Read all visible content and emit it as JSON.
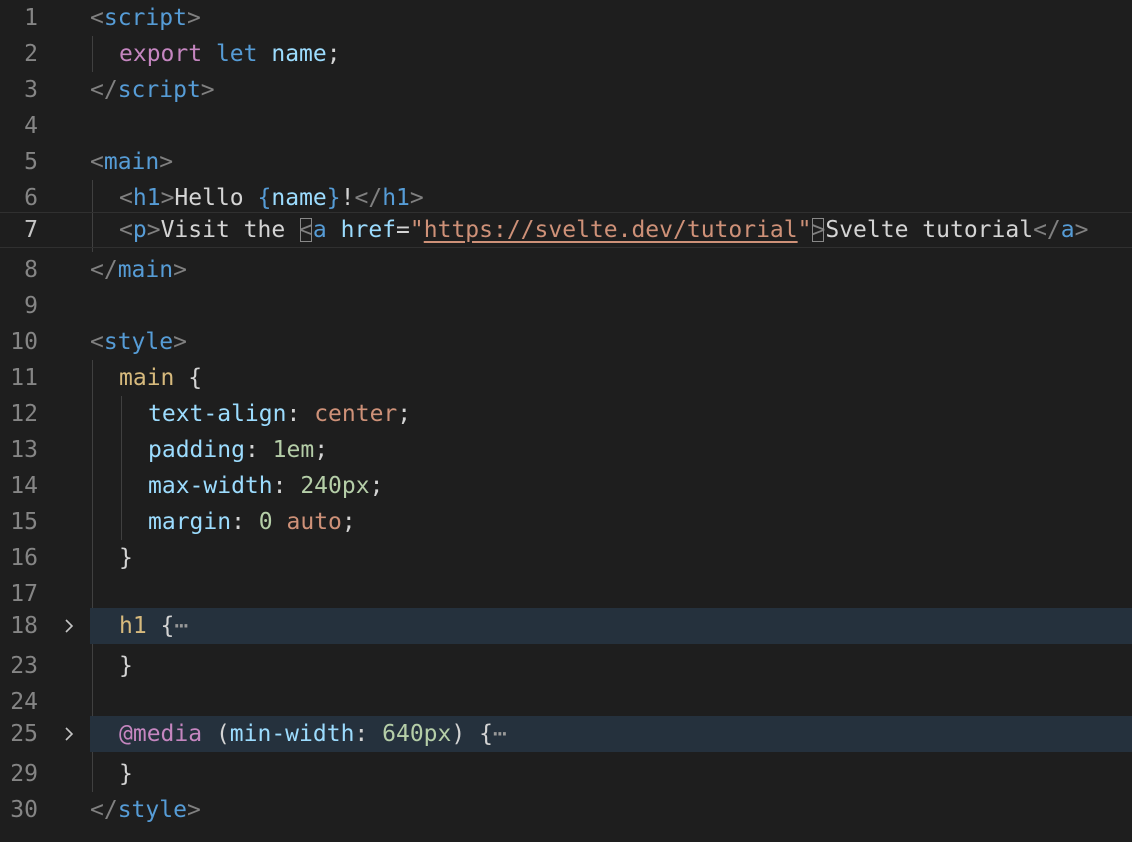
{
  "editor": {
    "line_numbers": [
      "1",
      "2",
      "3",
      "4",
      "5",
      "6",
      "7",
      "8",
      "9",
      "10",
      "11",
      "12",
      "13",
      "14",
      "15",
      "16",
      "17",
      "18",
      "23",
      "24",
      "25",
      "29",
      "30"
    ],
    "lines": {
      "l1": {
        "a": "<",
        "b": "script",
        "c": ">"
      },
      "l2": {
        "a": "export",
        "b": " ",
        "c": "let",
        "d": " name",
        "e": ";"
      },
      "l3": {
        "a": "</",
        "b": "script",
        "c": ">"
      },
      "l5": {
        "a": "<",
        "b": "main",
        "c": ">"
      },
      "l6": {
        "a": "<",
        "b": "h1",
        "c": ">",
        "d": "Hello ",
        "e": "{",
        "f": "name",
        "g": "}",
        "h": "!",
        "i": "</",
        "j": "h1",
        "k": ">"
      },
      "l7": {
        "a": "<",
        "b": "p",
        "c": ">",
        "d": "Visit the ",
        "e": "<",
        "f": "a",
        "g": " href",
        "h": "=",
        "i": "\"",
        "j": "https://svelte.dev/tutorial",
        "k": "\"",
        "l": ">",
        "m": "Svelte tutorial",
        "n": "</",
        "o": "a",
        "p": ">"
      },
      "l8": {
        "a": "</",
        "b": "main",
        "c": ">"
      },
      "l10": {
        "a": "<",
        "b": "style",
        "c": ">"
      },
      "l11": {
        "a": "main",
        "b": " {"
      },
      "l12": {
        "a": "text-align",
        "b": ": ",
        "c": "center",
        "d": ";"
      },
      "l13": {
        "a": "padding",
        "b": ": ",
        "c": "1em",
        "d": ";"
      },
      "l14": {
        "a": "max-width",
        "b": ": ",
        "c": "240px",
        "d": ";"
      },
      "l15": {
        "a": "margin",
        "b": ": ",
        "c": "0",
        "d": " ",
        "e": "auto",
        "f": ";"
      },
      "l16": {
        "a": "}"
      },
      "l18": {
        "a": "h1",
        "b": " {",
        "c": "⋯"
      },
      "l23": {
        "a": "}"
      },
      "l25": {
        "a": "@media",
        "b": " (",
        "c": "min-width",
        "d": ": ",
        "e": "640px",
        "f": ") {",
        "g": "⋯"
      },
      "l29": {
        "a": "}"
      },
      "l30": {
        "a": "</",
        "b": "style",
        "c": ">"
      }
    },
    "fold_icon": "chevron-right-icon",
    "colors": {
      "background": "#1e1e1e",
      "tag": "#569cd6",
      "keyword": "#c586c0",
      "selector": "#d7ba7d",
      "property": "#9cdcfe",
      "string": "#ce9178",
      "number": "#b5cea8",
      "folded_line": "#25313d"
    }
  }
}
